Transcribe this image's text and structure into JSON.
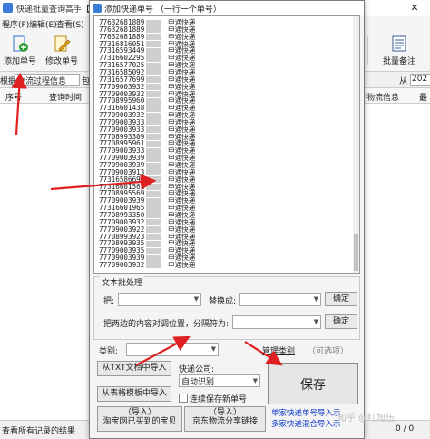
{
  "main": {
    "title": "快递批量查询高手【",
    "close_glyph": "✕",
    "menu": [
      "程序(F)",
      "编辑(E)",
      "查看(S)"
    ],
    "toolbar": {
      "add_label": "添加单号",
      "edit_label": "修改单号",
      "batch_note_label": "批量备注"
    },
    "filter": {
      "by_label": "根据",
      "field_value": "物流过程信息",
      "include_label": "包",
      "from_label": "从",
      "date_value": "202"
    },
    "grid_headers": {
      "index": "序号",
      "query_time": "查询时间",
      "logistics": "物流信息",
      "latest": "最"
    },
    "status": {
      "text": "查看所有记录的结果",
      "pages": "0 / 0"
    }
  },
  "dialog": {
    "title": "添加快递单号 （一行一个单号）",
    "tracking_list": [
      {
        "num": "77632681889",
        "carrier": "申通快递"
      },
      {
        "num": "77632681889",
        "carrier": "申通快递"
      },
      {
        "num": "77632681889",
        "carrier": "申通快递"
      },
      {
        "num": "77316816051",
        "carrier": "申通快递"
      },
      {
        "num": "77316593449",
        "carrier": "申通快递"
      },
      {
        "num": "77316602295",
        "carrier": "申通快递"
      },
      {
        "num": "77316577025",
        "carrier": "申通快递"
      },
      {
        "num": "77316585092",
        "carrier": "申通快递"
      },
      {
        "num": "77316577699",
        "carrier": "申通快递"
      },
      {
        "num": "77709003932",
        "carrier": "申通快递"
      },
      {
        "num": "77709003932",
        "carrier": "申通快递"
      },
      {
        "num": "77708995960",
        "carrier": "申通快递"
      },
      {
        "num": "77316601438",
        "carrier": "申通快递"
      },
      {
        "num": "77709003932",
        "carrier": "申通快递"
      },
      {
        "num": "77709003933",
        "carrier": "申通快递"
      },
      {
        "num": "77709003933",
        "carrier": "申通快递"
      },
      {
        "num": "77708993309",
        "carrier": "申通快递"
      },
      {
        "num": "77708995961",
        "carrier": "申通快递"
      },
      {
        "num": "77709003933",
        "carrier": "申通快递"
      },
      {
        "num": "77709003939",
        "carrier": "申通快递"
      },
      {
        "num": "77709003939",
        "carrier": "申通快递"
      },
      {
        "num": "77709003913",
        "carrier": "申通快递"
      },
      {
        "num": "77316586692",
        "carrier": "申通快递"
      },
      {
        "num": "77316601561",
        "carrier": "申通快递"
      },
      {
        "num": "77708995569",
        "carrier": "申通快递"
      },
      {
        "num": "77709003939",
        "carrier": "申通快递"
      },
      {
        "num": "77316601965",
        "carrier": "申通快递"
      },
      {
        "num": "77708993350",
        "carrier": "申通快递"
      },
      {
        "num": "77709003932",
        "carrier": "申通快递"
      },
      {
        "num": "77709003922",
        "carrier": "申通快递"
      },
      {
        "num": "77708993923",
        "carrier": "申通快递"
      },
      {
        "num": "77708993935",
        "carrier": "申通快递"
      },
      {
        "num": "77709003935",
        "carrier": "申通快递"
      },
      {
        "num": "77709003939",
        "carrier": "申通快递"
      },
      {
        "num": "77709003932",
        "carrier": "申通快递"
      }
    ],
    "text_processing": {
      "group_title": "文本批处理",
      "replace_from_label": "把:",
      "replace_to_label": "替换成:",
      "confirm_label": "确定",
      "swap_label": "把两边的内容对调位置，分隔符为:",
      "confirm2_label": "确定"
    },
    "category_label": "类别:",
    "manage_category_label": "管理类别",
    "optional_label": "（可选项）",
    "import_txt_label": "从TXT文档中导入",
    "import_table_label": "从表格模板中导入",
    "courier_label": "快递公司:",
    "courier_value": "自动识别",
    "continue_save_label": "连续保存新单号",
    "save_label": "保存",
    "taobao_import_label": "淘宝网已买到的宝贝",
    "taobao_import_top": "（导入）",
    "jd_import_label": "京东物流分享链接",
    "jd_import_top": "（导入）",
    "link_single": "单家快递单号导入示",
    "link_multi": "多家快递混合导入示",
    "watermark": "知乎 @红旭伍"
  },
  "colors": {
    "arrow": "#e02020",
    "link": "#0b37c9"
  }
}
